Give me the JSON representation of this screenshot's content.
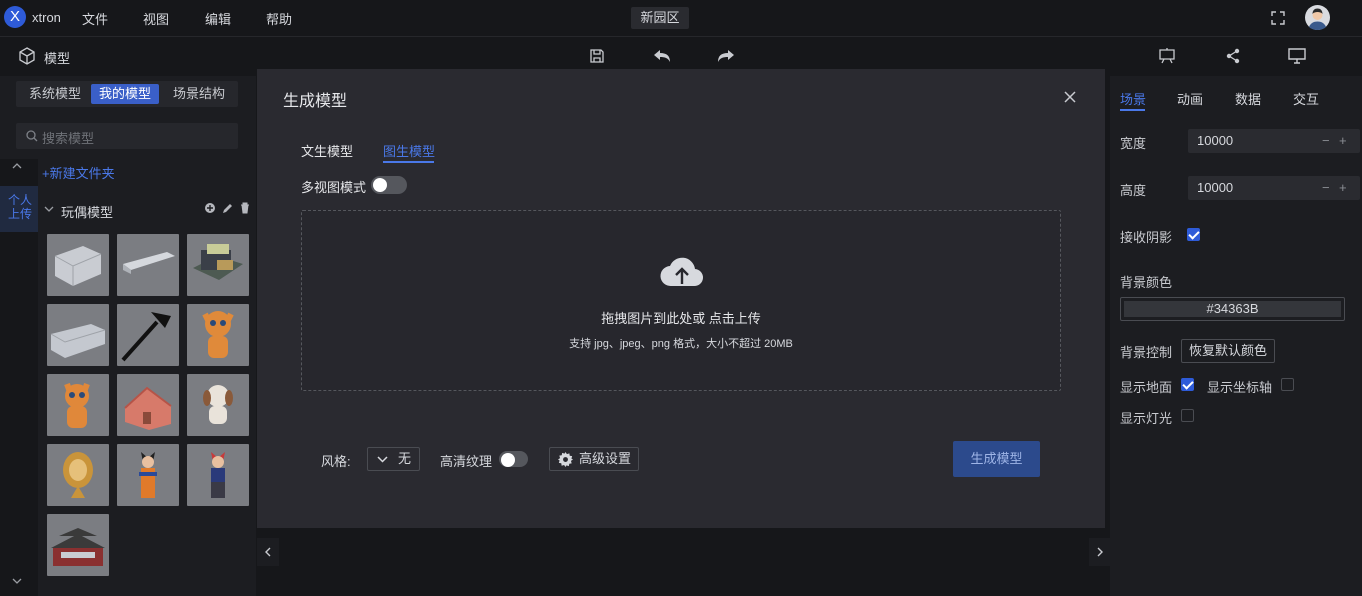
{
  "app": {
    "logo_letter": "X",
    "name": "xtron",
    "scene_name": "新园区"
  },
  "menu": [
    "文件",
    "视图",
    "编辑",
    "帮助"
  ],
  "toolbar": {
    "title": "模型"
  },
  "left": {
    "tabs": [
      "系统模型",
      "我的模型",
      "场景结构"
    ],
    "search_placeholder": "搜索模型",
    "new_folder": "+新建文件夹",
    "side_tab": [
      "个人",
      "上传"
    ],
    "folder_name": "玩偶模型"
  },
  "dialog": {
    "title": "生成模型",
    "tabs": [
      "文生模型",
      "图生模型"
    ],
    "multiview_label": "多视图模式",
    "upload_main": "拖拽图片到此处或 点击上传",
    "upload_sub": "支持 jpg、jpeg、png 格式，大小不超过 20MB",
    "style_label": "风格:",
    "style_value": "无",
    "hd_label": "高清纹理",
    "advanced_label": "高级设置",
    "generate_label": "生成模型"
  },
  "right": {
    "tabs": [
      "场景",
      "动画",
      "数据",
      "交互"
    ],
    "width_label": "宽度",
    "width_value": "10000",
    "height_label": "高度",
    "height_value": "10000",
    "shadow_label": "接收阴影",
    "bg_color_label": "背景颜色",
    "bg_color_value": "#34363B",
    "bg_control_label": "背景控制",
    "restore_label": "恢复默认颜色",
    "ground_label": "显示地面",
    "axis_label": "显示坐标轴",
    "light_label": "显示灯光"
  },
  "colors": {
    "accent": "#2e5bd8",
    "bg_color_swatch": "#34363B"
  }
}
